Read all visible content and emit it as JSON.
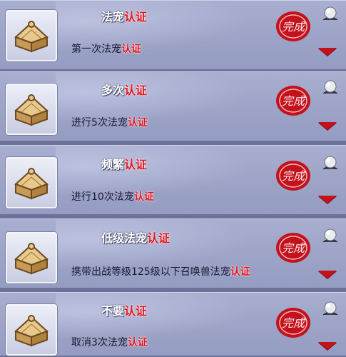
{
  "quests": [
    {
      "title_main": "法宠",
      "title_accent": "认证",
      "desc_main": "第一次法宠",
      "desc_accent": "认证",
      "seal_text": "完成"
    },
    {
      "title_main": "多次",
      "title_accent": "认证",
      "desc_main": "进行5次法宠",
      "desc_accent": "认证",
      "seal_text": "完成"
    },
    {
      "title_main": "频繁",
      "title_accent": "认证",
      "desc_main": "进行10次法宠",
      "desc_accent": "认证",
      "seal_text": "完成"
    },
    {
      "title_main": "低级法宠",
      "title_accent": "认证",
      "desc_main": "携带出战等级125级以下召唤兽法宠",
      "desc_accent": "认证",
      "seal_text": "完成"
    },
    {
      "title_main": "不要",
      "title_accent": "认证",
      "desc_main": "取消3次法宠",
      "desc_accent": "认证",
      "seal_text": "完成"
    }
  ],
  "icons": {
    "reward": "treasure-chest-icon",
    "seal": "completed-seal-icon",
    "orb": "pearl-orb-icon",
    "expand": "expand-arrow-icon"
  },
  "colors": {
    "accent": "#e3141d",
    "panel": "#9ea5c8",
    "seal": "#c3121c"
  }
}
